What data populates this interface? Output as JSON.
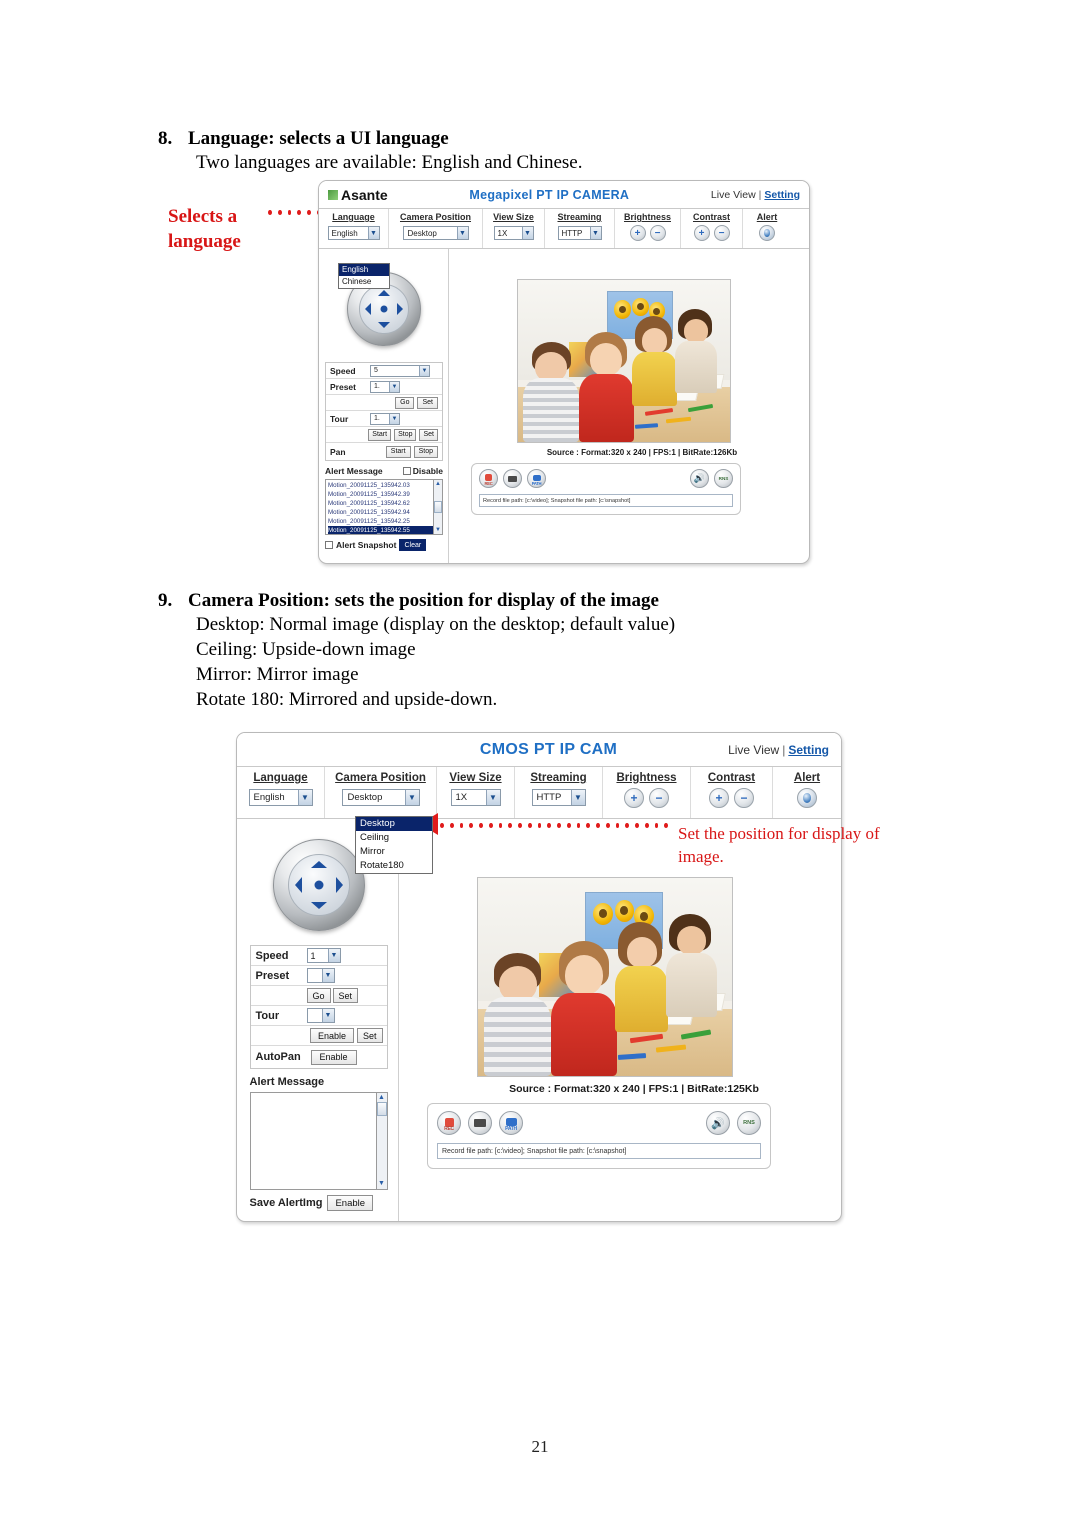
{
  "page": {
    "number": "21"
  },
  "sections": [
    {
      "number": "8.",
      "heading": "Language: selects a UI language",
      "lines": [
        "Two languages are available: English and Chinese."
      ]
    },
    {
      "number": "9.",
      "heading": "Camera Position: sets the position for display of the image",
      "lines": [
        "Desktop: Normal image (display on the desktop; default value)",
        "Ceiling: Upside-down image",
        "Mirror: Mirror image",
        "Rotate 180: Mirrored and upside-down."
      ]
    }
  ],
  "annotations": {
    "language": "Selects a language",
    "camera_position": "Set the position for display of image."
  },
  "screenshot1": {
    "brand": "Asante",
    "title": "Megapixel PT IP CAMERA",
    "links": {
      "live_view": "Live View",
      "separator": "|",
      "setting": "Setting"
    },
    "toolbar": [
      {
        "label": "Language",
        "type": "select",
        "value": "English"
      },
      {
        "label": "Camera Position",
        "type": "select",
        "value": "Desktop"
      },
      {
        "label": "View Size",
        "type": "select",
        "value": "1X"
      },
      {
        "label": "Streaming",
        "type": "select",
        "value": "HTTP"
      },
      {
        "label": "Brightness",
        "type": "plusminus",
        "plus": "+",
        "minus": "−"
      },
      {
        "label": "Contrast",
        "type": "plusminus",
        "plus": "+",
        "minus": "−"
      },
      {
        "label": "Alert",
        "type": "icon"
      }
    ],
    "language_dropdown": {
      "open": true,
      "options": [
        "English",
        "Chinese"
      ],
      "selected": "English"
    },
    "controls": {
      "speed": {
        "label": "Speed",
        "value": "5"
      },
      "preset": {
        "label": "Preset",
        "value": "1."
      },
      "preset_buttons": [
        "Go",
        "Set"
      ],
      "tour": {
        "label": "Tour",
        "value": "1."
      },
      "tour_buttons": [
        "Start",
        "Stop",
        "Set"
      ],
      "pan": {
        "label": "Pan",
        "buttons": [
          "Start",
          "Stop"
        ]
      }
    },
    "alert": {
      "title": "Alert Message",
      "disable_label": "Disable",
      "messages": [
        "Motion_20091125_135942.03",
        "Motion_20091125_135942.39",
        "Motion_20091125_135942.62",
        "Motion_20091125_135942.94",
        "Motion_20091125_135942.25",
        "Motion_20091125_135942.55"
      ],
      "selected_index": 5,
      "snapshot_label": "Alert Snapshot",
      "clear_button": "Clear"
    },
    "source": "Source : Format:320 x 240 | FPS:1 | BitRate:126Kb",
    "source_label": "Source :",
    "source_value": " Format:320 x 240 | FPS:1 | BitRate:126Kb",
    "player_buttons": [
      "REC",
      "SNAPSHOT",
      "PATH",
      "AUDIO",
      "RNS"
    ],
    "path_text": "Record file path: [c:\\video]; Snapshot file path: [c:\\snapshot]"
  },
  "screenshot2": {
    "title": "CMOS PT IP CAM",
    "links": {
      "live_view": "Live View",
      "separator": "|",
      "setting": "Setting"
    },
    "toolbar": [
      {
        "label": "Language",
        "type": "select",
        "value": "English"
      },
      {
        "label": "Camera Position",
        "type": "select",
        "value": "Desktop"
      },
      {
        "label": "View Size",
        "type": "select",
        "value": "1X"
      },
      {
        "label": "Streaming",
        "type": "select",
        "value": "HTTP"
      },
      {
        "label": "Brightness",
        "type": "plusminus",
        "plus": "+",
        "minus": "−"
      },
      {
        "label": "Contrast",
        "type": "plusminus",
        "plus": "+",
        "minus": "−"
      },
      {
        "label": "Alert",
        "type": "icon"
      }
    ],
    "position_dropdown": {
      "open": true,
      "options": [
        "Desktop",
        "Ceiling",
        "Mirror",
        "Rotate180"
      ],
      "selected": "Desktop"
    },
    "controls": {
      "speed": {
        "label": "Speed",
        "value": "1"
      },
      "preset": {
        "label": "Preset",
        "value": ""
      },
      "preset_buttons": [
        "Go",
        "Set"
      ],
      "tour": {
        "label": "Tour",
        "value": ""
      },
      "tour_buttons": [
        "Enable",
        "Set"
      ],
      "autopan": {
        "label": "AutoPan",
        "button": "Enable"
      }
    },
    "alert": {
      "title": "Alert Message",
      "messages": [],
      "save_label": "Save AlertImg",
      "save_button": "Enable"
    },
    "source_label": "Source :",
    "source_value": " Format:320 x 240 | FPS:1 | BitRate:125Kb",
    "player_buttons": [
      "REC",
      "SNAPSHOT",
      "PATH",
      "AUDIO",
      "RNS"
    ],
    "path_text": "Record file path: [c:\\video]; Snapshot file path: [c:\\snapshot]"
  },
  "colors": {
    "annotation_red": "#d81616",
    "title_blue": "#1f6fc4",
    "link_blue": "#1457a8",
    "select_highlight": "#0a246a"
  }
}
